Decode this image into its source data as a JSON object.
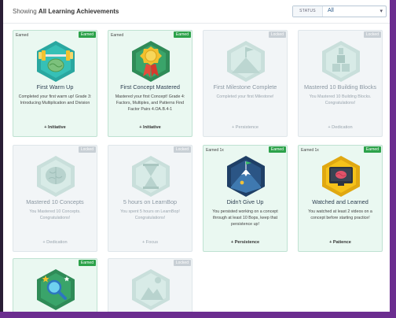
{
  "header": {
    "showing_prefix": "Showing",
    "showing_filter": "All Learning Achievements"
  },
  "filter": {
    "label": "STATUS",
    "value": "All"
  },
  "colors": {
    "earned_badge": "#2ca24a",
    "locked_badge": "#c8cfd5",
    "earned_card_bg": "#eaf8f1",
    "window_frame": "#6b2d8f"
  },
  "cards": [
    {
      "status_text": "Earned",
      "badge": "Earned",
      "state": "earned",
      "icon": "barbell-brain-icon",
      "title": "First Warm Up",
      "description": "Completed your first warm up! Grade 3: Introducing Multiplication and Division",
      "tag": "+ Initiative"
    },
    {
      "status_text": "Earned",
      "badge": "Earned",
      "state": "earned",
      "icon": "ribbon-medal-icon",
      "title": "First Concept Mastered",
      "description": "Mastered your first Concept! Grade 4: Factors, Multiples, and Patterns Find Factor Pairs 4.OA.B.4-1",
      "tag": "+ Initiative"
    },
    {
      "status_text": "",
      "badge": "Locked",
      "state": "locked",
      "icon": "flag-mountain-icon",
      "title": "First Milestone Complete",
      "description": "Completed your first Milestone!",
      "tag": "+ Persistence"
    },
    {
      "status_text": "",
      "badge": "Locked",
      "state": "locked",
      "icon": "building-blocks-icon",
      "title": "Mastered 10 Building Blocks",
      "description": "You Mastered 10 Building Blocks. Congratulations!",
      "tag": "+ Dedication"
    },
    {
      "status_text": "",
      "badge": "Locked",
      "state": "locked",
      "icon": "brain-icon",
      "title": "Mastered 10 Concepts",
      "description": "You Mastered 10 Concepts. Congratulations!",
      "tag": "+ Dedication"
    },
    {
      "status_text": "",
      "badge": "Locked",
      "state": "locked",
      "icon": "hourglass-icon",
      "title": "5 hours on LearnBop",
      "description": "You spent 5 hours on LearnBop! Congratulations!",
      "tag": "+ Focus"
    },
    {
      "status_text": "Earned 1x",
      "badge": "Earned",
      "state": "earned",
      "icon": "mountain-climber-icon",
      "title": "Didn't Give Up",
      "description": "You persisted working on a concept through at least 10 Bops, keep that persistence up!",
      "tag": "+ Persistence"
    },
    {
      "status_text": "Earned 1x",
      "badge": "Earned",
      "state": "earned",
      "icon": "video-brain-icon",
      "title": "Watched and Learned",
      "description": "You watched at least 2 videos on a concept before starting practice!",
      "tag": "+ Patience"
    },
    {
      "status_text": "",
      "badge": "Earned",
      "state": "earned",
      "icon": "magnifier-stars-icon",
      "title": "",
      "description": "",
      "tag": ""
    },
    {
      "status_text": "",
      "badge": "Locked",
      "state": "locked",
      "icon": "locked-medal-icon",
      "title": "",
      "description": "",
      "tag": ""
    }
  ]
}
